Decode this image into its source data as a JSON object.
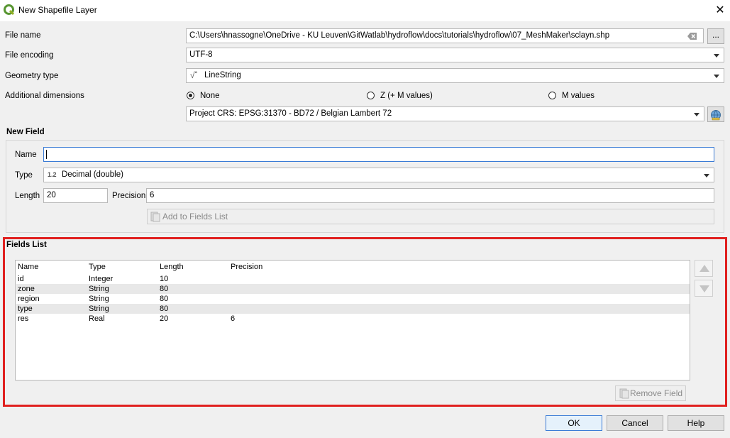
{
  "window": {
    "title": "New Shapefile Layer",
    "close_glyph": "✕",
    "icon": "qgis-logo-icon"
  },
  "form": {
    "file_name_label": "File name",
    "file_name_value": "C:\\Users\\hnassogne\\OneDrive - KU Leuven\\GitWatlab\\hydroflow\\docs\\tutorials\\hydroflow\\07_MeshMaker\\sclayn.shp",
    "browse_label": "...",
    "file_encoding_label": "File encoding",
    "file_encoding_value": "UTF-8",
    "geometry_type_label": "Geometry type",
    "geometry_type_value": "LineString",
    "geometry_icon_glyph": "√˚",
    "additional_dimensions_label": "Additional dimensions",
    "dimensions_options": [
      "None",
      "Z (+ M values)",
      "M values"
    ],
    "dimensions_selected": "None",
    "crs_value": "Project CRS: EPSG:31370 - BD72 / Belgian Lambert 72"
  },
  "new_field": {
    "title": "New Field",
    "name_label": "Name",
    "name_value": "",
    "type_label": "Type",
    "type_badge": "1.2",
    "type_value": "Decimal (double)",
    "length_label": "Length",
    "length_value": "20",
    "precision_label": "Precision",
    "precision_value": "6",
    "add_button_label": "Add to Fields List"
  },
  "fields_list": {
    "title": "Fields List",
    "columns": [
      "Name",
      "Type",
      "Length",
      "Precision"
    ],
    "rows": [
      [
        "id",
        "Integer",
        "10",
        ""
      ],
      [
        "zone",
        "String",
        "80",
        ""
      ],
      [
        "region",
        "String",
        "80",
        ""
      ],
      [
        "type",
        "String",
        "80",
        ""
      ],
      [
        "res",
        "Real",
        "20",
        "6"
      ]
    ],
    "remove_button_label": "Remove Field",
    "highlight_color": "#e0201f"
  },
  "footer": {
    "ok_label": "OK",
    "cancel_label": "Cancel",
    "help_label": "Help"
  }
}
